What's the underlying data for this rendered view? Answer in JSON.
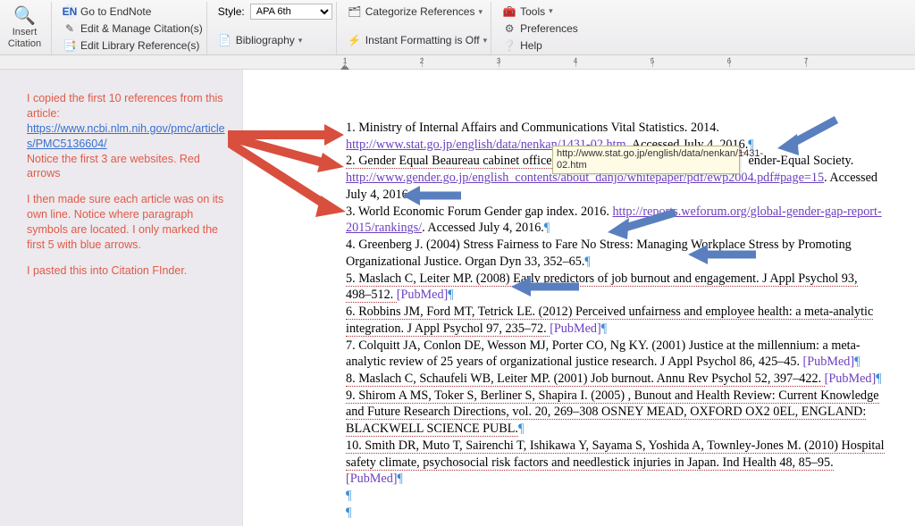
{
  "toolbar": {
    "insert_citation_label": "Insert\nCitation",
    "go_to_endnote": "Go to EndNote",
    "edit_manage": "Edit & Manage Citation(s)",
    "edit_library": "Edit Library Reference(s)",
    "style_label": "Style:",
    "style_value": "APA 6th",
    "bibliography": "Bibliography",
    "categorize": "Categorize References",
    "instant_fmt": "Instant Formatting is Off",
    "tools": "Tools",
    "preferences": "Preferences",
    "help": "Help"
  },
  "ruler": {
    "marks": [
      "1",
      "2",
      "3",
      "4",
      "5",
      "6",
      "7"
    ]
  },
  "notes": {
    "p1a": "I copied the first 10 references from this article:",
    "p1b": "https://www.ncbi.nlm.nih.gov/pmc/articles/PMC5136604/",
    "p1c": "Notice the first 3 are websites. Red arrows",
    "p2": "I then made sure each article was on its own line. Notice where paragraph symbols are located. I only marked the first 5 with blue arrows.",
    "p3": "I pasted this into Citation FInder."
  },
  "tooltip": {
    "text": "http://www.stat.go.jp/english/data/nenkan/1431-02.htm"
  },
  "doc": {
    "r1a": "1. Ministry of Internal Affairs and Communications Vital Statistics. 2014.",
    "r1link": "http://www.stat.go.jp/english/data/nenkan/1431-02.htm",
    "r1b": ". Accessed July 4, 2016.",
    "r2a": "2. Gender Equal Beaureau cabinet office",
    "r2mid": "ender-Equal Society. ",
    "r2link": "http://www.gender.go.jp/english_contents/about_danjo/whitepaper/pdf/ewp2004.pdf#page=15",
    "r2b": ". Accessed July 4, 2016.",
    "r3a": "3. World Economic Forum Gender gap index. 2016. ",
    "r3link": "http://reports.weforum.org/global-gender-gap-report-2015/rankings/",
    "r3b": ". Accessed July 4, 2016.",
    "r4": "4. Greenberg J. (2004) Stress Fairness to Fare No Stress: Managing Workplace Stress by Promoting Organizational Justice. Organ Dyn 33, 352–65.",
    "r5": "5. Maslach C, Leiter MP. (2008) Early predictors of job burnout and engagement. J Appl Psychol 93, 498–512. ",
    "r6": "6. Robbins JM, Ford MT, Tetrick LE. (2012) Perceived unfairness and employee health: a meta-analytic integration. J Appl Psychol 97, 235–72. ",
    "r7": "7. Colquitt JA, Conlon DE, Wesson MJ, Porter CO, Ng KY. (2001) Justice at the millennium: a meta-analytic review of 25 years of organizational justice research. J Appl Psychol 86, 425–45. ",
    "r8": "8. Maslach C, Schaufeli WB, Leiter MP. (2001) Job burnout. Annu Rev Psychol 52, 397–422. ",
    "r9": "9. Shirom A MS, Toker S, Berliner S, Shapira I. (2005) , Bunout and Health Review: Current Knowledge and Future Research Directions, vol. 20, 269–308 OSNEY MEAD, OXFORD OX2 0EL, ENGLAND: BLACKWELL SCIENCE PUBL.",
    "r10": "10. Smith DR, Muto T, Sairenchi T, Ishikawa Y, Sayama S, Yoshida A, Townley-Jones M. (2010) Hospital safety climate, psychosocial risk factors and needlestick injuries in Japan. Ind Health 48, 85–95. ",
    "pubmed": "[PubMed]",
    "pilcrow": "¶"
  }
}
